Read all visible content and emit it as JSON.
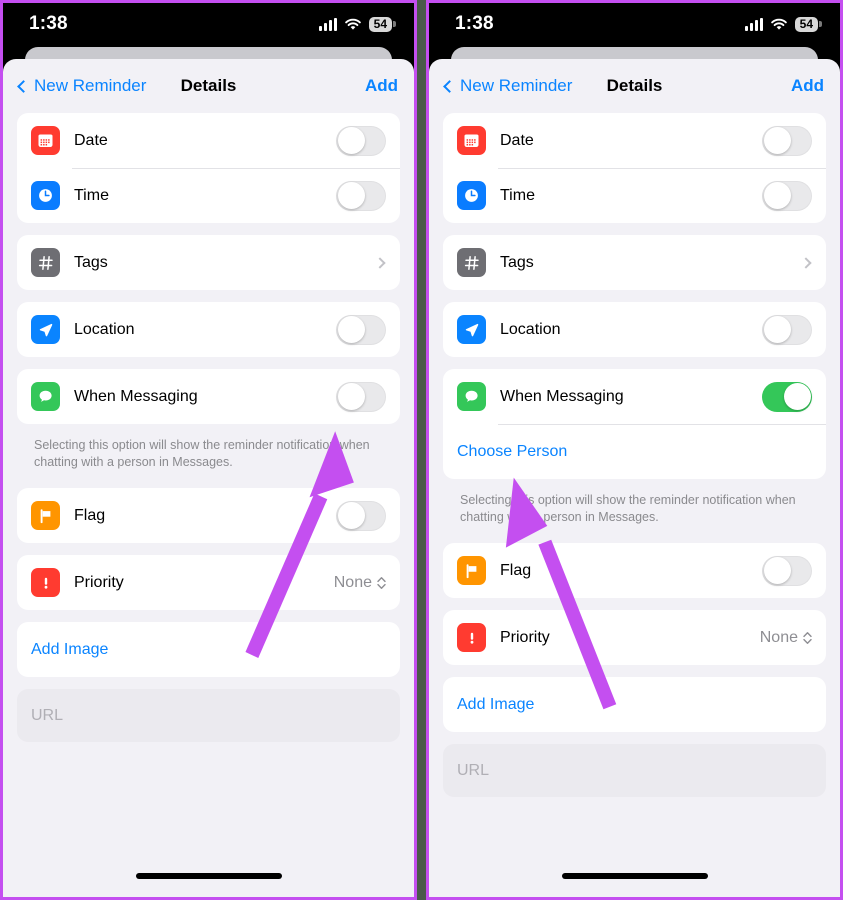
{
  "status_bar": {
    "time": "1:38",
    "battery_level": "54",
    "signal_icon": "cellular-signal-icon",
    "wifi_icon": "wifi-icon",
    "battery_icon": "battery-icon"
  },
  "nav": {
    "back_label": "New Reminder",
    "title": "Details",
    "action_label": "Add",
    "back_icon": "chevron-left-icon"
  },
  "colors": {
    "accent_blue": "#0a84ff",
    "toggle_on_green": "#34c759",
    "toggle_off_gray": "#e9e9eb",
    "annotation_purple": "#c44ff0",
    "sheet_bg": "#f2f1f6",
    "card_bg": "#ffffff",
    "icon_red": "#ff3b30",
    "icon_blue": "#0a7cff",
    "icon_gray": "#6e6e73",
    "icon_orange": "#ff9500",
    "icon_green": "#34c759"
  },
  "footnote": "Selecting this option will show the reminder notification when chatting with a person in Messages.",
  "left_panel": {
    "name": "before-state",
    "rows": {
      "date": {
        "label": "Date",
        "icon": "calendar-icon",
        "toggle": "off"
      },
      "time": {
        "label": "Time",
        "icon": "clock-icon",
        "toggle": "off"
      },
      "tags": {
        "label": "Tags",
        "icon": "hashtag-icon",
        "accessory": "chevron-right-icon"
      },
      "location": {
        "label": "Location",
        "icon": "navigation-arrow-icon",
        "toggle": "off"
      },
      "when_messaging": {
        "label": "When Messaging",
        "icon": "message-bubble-icon",
        "toggle": "off"
      },
      "flag": {
        "label": "Flag",
        "icon": "flag-icon",
        "toggle": "off"
      },
      "priority": {
        "label": "Priority",
        "icon": "exclamation-icon",
        "value": "None",
        "accessory": "up-down-chevron-icon"
      },
      "add_image": {
        "label": "Add Image"
      },
      "url": {
        "placeholder": "URL",
        "value": ""
      }
    }
  },
  "right_panel": {
    "name": "after-state",
    "rows": {
      "date": {
        "label": "Date",
        "icon": "calendar-icon",
        "toggle": "off"
      },
      "time": {
        "label": "Time",
        "icon": "clock-icon",
        "toggle": "off"
      },
      "tags": {
        "label": "Tags",
        "icon": "hashtag-icon",
        "accessory": "chevron-right-icon"
      },
      "location": {
        "label": "Location",
        "icon": "navigation-arrow-icon",
        "toggle": "off"
      },
      "when_messaging": {
        "label": "When Messaging",
        "icon": "message-bubble-icon",
        "toggle": "on"
      },
      "choose_person": {
        "label": "Choose Person"
      },
      "flag": {
        "label": "Flag",
        "icon": "flag-icon",
        "toggle": "off"
      },
      "priority": {
        "label": "Priority",
        "icon": "exclamation-icon",
        "value": "None",
        "accessory": "up-down-chevron-icon"
      },
      "add_image": {
        "label": "Add Image"
      },
      "url": {
        "placeholder": "URL",
        "value": ""
      }
    }
  }
}
